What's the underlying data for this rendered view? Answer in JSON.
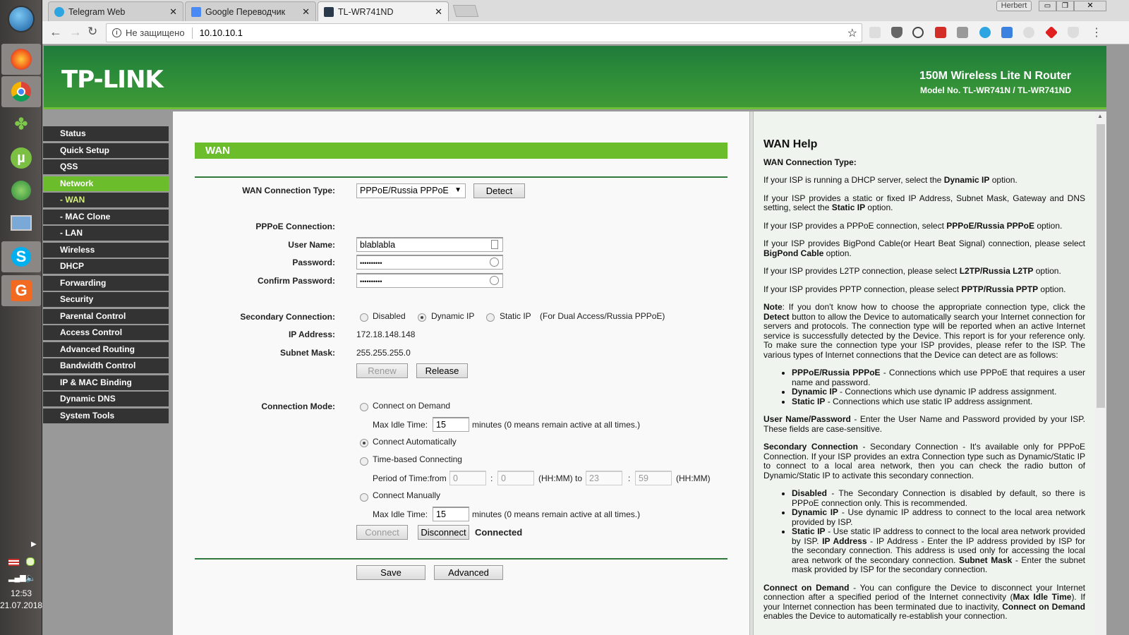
{
  "taskbar": {
    "time": "12:53",
    "date": "21.07.2018"
  },
  "browser": {
    "tabs": [
      {
        "title": "Telegram Web"
      },
      {
        "title": "Google Переводчик"
      },
      {
        "title": "TL-WR741ND"
      }
    ],
    "profile": "Herbert",
    "security_label": "Не защищено",
    "url": "10.10.10.1"
  },
  "banner": {
    "logo": "TP-LINK",
    "product": "150M Wireless Lite N Router",
    "model": "Model No. TL-WR741N / TL-WR741ND"
  },
  "menu": [
    "Status",
    "Quick Setup",
    "QSS",
    "Network",
    "- WAN",
    "- MAC Clone",
    "- LAN",
    "Wireless",
    "DHCP",
    "Forwarding",
    "Security",
    "Parental Control",
    "Access Control",
    "Advanced Routing",
    "Bandwidth Control",
    "IP & MAC Binding",
    "Dynamic DNS",
    "System Tools"
  ],
  "form": {
    "title": "WAN",
    "conn_type_label": "WAN Connection Type:",
    "conn_type_value": "PPPoE/Russia PPPoE",
    "detect": "Detect",
    "pppoe_label": "PPPoE Connection:",
    "user_label": "User Name:",
    "user_value": "blablabla",
    "pass_label": "Password:",
    "pass_value": "••••••••••",
    "confirm_label": "Confirm Password:",
    "confirm_value": "••••••••••",
    "secondary_label": "Secondary Connection:",
    "sec_disabled": "Disabled",
    "sec_dynamic": "Dynamic IP",
    "sec_static": "Static IP",
    "sec_note": "(For Dual Access/Russia PPPoE)",
    "ip_label": "IP Address:",
    "ip_value": "172.18.148.148",
    "mask_label": "Subnet Mask:",
    "mask_value": "255.255.255.0",
    "renew": "Renew",
    "release": "Release",
    "mode_label": "Connection Mode:",
    "on_demand": "Connect on Demand",
    "max_idle_label": "Max Idle Time:",
    "idle1": "15",
    "idle_note": "minutes (0 means remain active at all times.)",
    "auto": "Connect Automatically",
    "time_based": "Time-based Connecting",
    "period_label": "Period of Time:from",
    "from_h": "0",
    "from_m": "0",
    "hhmm_to": "(HH:MM) to",
    "to_h": "23",
    "to_m": "59",
    "hhmm": "(HH:MM)",
    "colon": ":",
    "manual": "Connect Manually",
    "idle2": "15",
    "connect": "Connect",
    "disconnect": "Disconnect",
    "status": "Connected",
    "save": "Save",
    "advanced": "Advanced"
  },
  "help": {
    "title": "WAN Help",
    "h_type": "WAN Connection Type:",
    "p1a": "If your ISP is running a DHCP server, select the ",
    "p1b": "Dynamic IP",
    "p1c": " option.",
    "p2a": "If your ISP provides a static or fixed IP Address, Subnet Mask, Gateway and DNS setting, select the ",
    "p2b": "Static IP",
    "p2c": " option.",
    "p3a": "If your ISP provides a PPPoE connection, select ",
    "p3b": "PPPoE/Russia PPPoE",
    "p3c": " option.",
    "p4a": "If your ISP provides BigPond Cable(or Heart Beat Signal) connection, please select ",
    "p4b": "BigPond Cable",
    "p4c": " option.",
    "p5a": "If your ISP provides L2TP connection, please select ",
    "p5b": "L2TP/Russia L2TP",
    "p5c": " option.",
    "p6a": "If your ISP provides PPTP connection, please select ",
    "p6b": "PPTP/Russia PPTP",
    "p6c": " option.",
    "note_a": "Note",
    "note_b": ": If you don't know how to choose the appropriate connection type, click the ",
    "note_c": "Detect",
    "note_d": " button to allow the Device to automatically search your Internet connection for servers and protocols. The connection type will be reported when an active Internet service is successfully detected by the Device. This report is for your reference only. To make sure the connection type your ISP provides, please refer to the ISP. The various types of Internet connections that the Device can detect are as follows:",
    "l1a": "PPPoE/Russia PPPoE",
    "l1b": " - Connections which use PPPoE that requires a user name and password.",
    "l2a": "Dynamic IP",
    "l2b": " - Connections which use dynamic IP address assignment.",
    "l3a": "Static IP",
    "l3b": " - Connections which use static IP address assignment.",
    "up_a": "User Name/Password",
    "up_b": " - Enter the User Name and Password provided by your ISP. These fields are case-sensitive.",
    "sc_a": "Secondary Connection",
    "sc_b": " - Secondary Connection - It's available only for PPPoE Connection. If your ISP provides an extra Connection type such as Dynamic/Static IP to connect to a local area network, then you can check the radio button of Dynamic/Static IP to activate this secondary connection.",
    "s1a": "Disabled",
    "s1b": " - The Secondary Connection is disabled by default, so there is PPPoE connection only. This is recommended.",
    "s2a": "Dynamic IP",
    "s2b": " - Use dynamic IP address to connect to the local area network provided by ISP.",
    "s3a": "Static IP",
    "s3b": " - Use static IP address to connect to the local area network provided by ISP. ",
    "s3c": "IP Address",
    "s3d": " - IP Address - Enter the IP address provided by ISP for the secondary connection. This address is used only for accessing the local area network of the secondary connection. ",
    "s3e": "Subnet Mask",
    "s3f": " - Enter the subnet mask provided by ISP for the secondary connection.",
    "cd_a": "Connect on Demand",
    "cd_b": " - You can configure the Device to disconnect your Internet connection after a specified period of the Internet connectivity (",
    "cd_c": "Max Idle Time",
    "cd_d": "). If your Internet connection has been terminated due to inactivity, ",
    "cd_e": "Connect on Demand",
    "cd_f": " enables the Device to automatically re-establish your connection."
  }
}
